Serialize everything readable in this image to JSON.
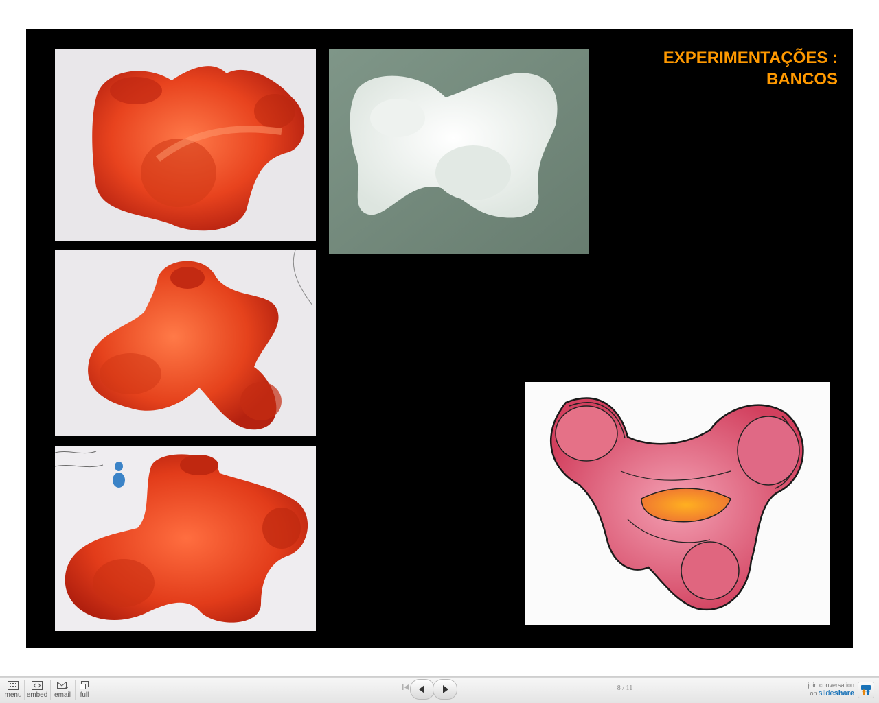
{
  "slide": {
    "title_line1": "EXPERIMENTAÇÕES :",
    "title_line2": "BANCOS",
    "accent_color": "#ff9900"
  },
  "toolbar": {
    "menu_label": "menu",
    "embed_label": "embed",
    "email_label": "email",
    "full_label": "full",
    "counter": "8 / 11",
    "join_line1": "join conversation",
    "join_prefix": "on",
    "brand_slide": "slide",
    "brand_share": "share"
  },
  "icons": [
    "menu-grid-icon",
    "embed-code-icon",
    "email-envelope-icon",
    "fullscreen-icon",
    "first-slide-icon",
    "previous-arrow-icon",
    "next-arrow-icon",
    "slideshare-logo-icon"
  ]
}
